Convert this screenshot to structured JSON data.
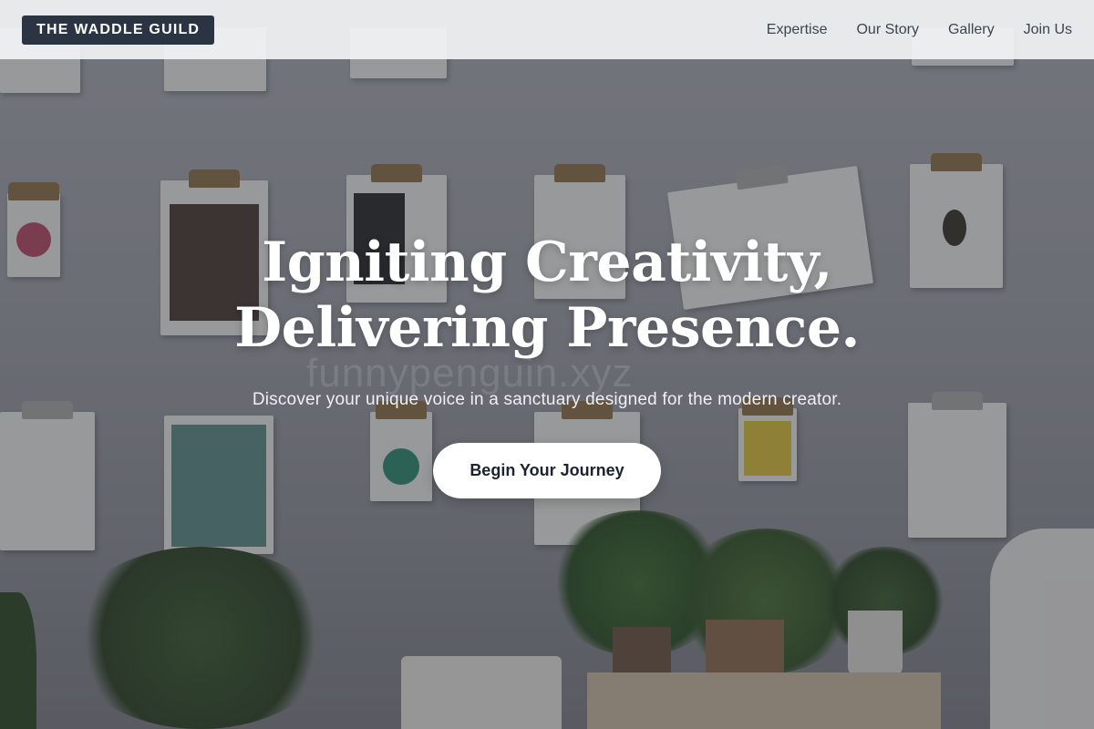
{
  "header": {
    "brand": "THE WADDLE GUILD",
    "nav": [
      "Expertise",
      "Our Story",
      "Gallery",
      "Join Us"
    ]
  },
  "hero": {
    "title_line1": "Igniting Creativity,",
    "title_line2": "Delivering Presence.",
    "subtitle": "Discover your unique voice in a sanctuary designed for the modern creator.",
    "cta_label": "Begin Your Journey",
    "watermark": "funnypenguin.xyz"
  },
  "colors": {
    "brand_bg": "#2b3443",
    "cta_bg": "#ffffff",
    "header_bg": "#f5f6f7"
  },
  "background": {
    "scene": "photo of clipboards with magazine pages pinned on a white wall above potted plants"
  }
}
